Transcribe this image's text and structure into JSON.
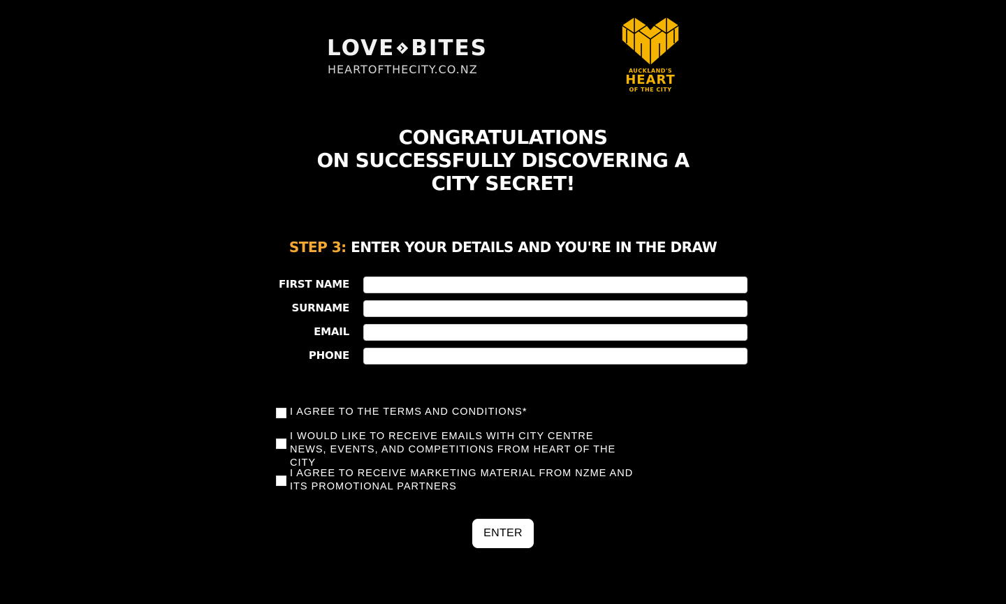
{
  "header": {
    "lovebites_logo": {
      "word_left": "LOVE",
      "word_right": "BITES",
      "url": "HEARTOFTHECITY.CO.NZ",
      "icon": "arrow-chevron-icon"
    },
    "hotc_logo": {
      "line1": "AUCKLAND'S",
      "line2": "HEART",
      "line3": "OF THE CITY",
      "icon": "buildings-heart-icon",
      "color": "#f5b400"
    }
  },
  "headline": {
    "line1": "CONGRATULATIONS",
    "line2": "ON SUCCESSFULLY DISCOVERING A",
    "line3": "CITY SECRET!"
  },
  "step": {
    "number": "STEP 3:",
    "text": "ENTER YOUR DETAILS AND YOU'RE IN THE DRAW",
    "accent_color": "#f7a935"
  },
  "form": {
    "fields": [
      {
        "label": "FIRST NAME",
        "value": "",
        "placeholder": ""
      },
      {
        "label": "SURNAME",
        "value": "",
        "placeholder": ""
      },
      {
        "label": "EMAIL",
        "value": "",
        "placeholder": ""
      },
      {
        "label": "PHONE",
        "value": "",
        "placeholder": ""
      }
    ],
    "checkboxes": [
      {
        "label": "I AGREE TO THE TERMS AND CONDITIONS*",
        "checked": false
      },
      {
        "label": "I WOULD LIKE TO RECEIVE EMAILS WITH CITY CENTRE NEWS, EVENTS, AND COMPETITIONS FROM HEART OF THE CITY",
        "checked": false
      },
      {
        "label": "I AGREE TO RECEIVE MARKETING MATERIAL FROM NZME AND ITS PROMOTIONAL PARTNERS",
        "checked": false
      }
    ],
    "submit_label": "ENTER"
  },
  "colors": {
    "background": "#000000",
    "text": "#ffffff",
    "accent": "#f7a935"
  }
}
